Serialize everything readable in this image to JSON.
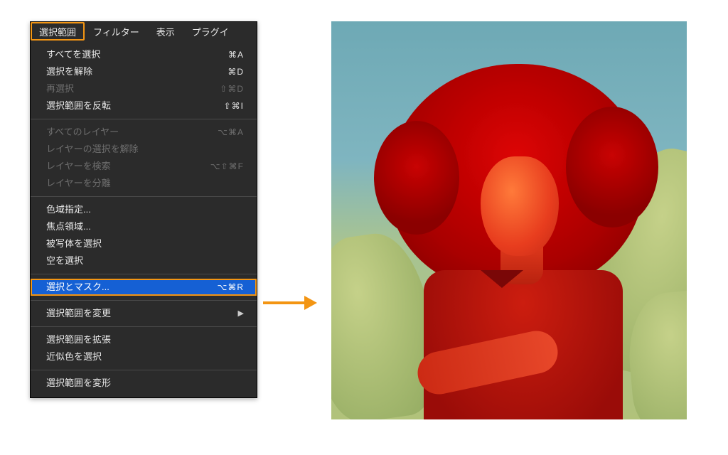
{
  "menubar": {
    "items": [
      {
        "label": "選択範囲",
        "active": true
      },
      {
        "label": "フィルター",
        "active": false
      },
      {
        "label": "表示",
        "active": false
      },
      {
        "label": "プラグイ",
        "active": false
      }
    ]
  },
  "dropdown": {
    "sections": [
      [
        {
          "label": "すべてを選択",
          "shortcut": "⌘A",
          "enabled": true
        },
        {
          "label": "選択を解除",
          "shortcut": "⌘D",
          "enabled": true
        },
        {
          "label": "再選択",
          "shortcut": "⇧⌘D",
          "enabled": false
        },
        {
          "label": "選択範囲を反転",
          "shortcut": "⇧⌘I",
          "enabled": true
        }
      ],
      [
        {
          "label": "すべてのレイヤー",
          "shortcut": "⌥⌘A",
          "enabled": false
        },
        {
          "label": "レイヤーの選択を解除",
          "shortcut": "",
          "enabled": false
        },
        {
          "label": "レイヤーを検索",
          "shortcut": "⌥⇧⌘F",
          "enabled": false
        },
        {
          "label": "レイヤーを分離",
          "shortcut": "",
          "enabled": false
        }
      ],
      [
        {
          "label": "色域指定...",
          "shortcut": "",
          "enabled": true
        },
        {
          "label": "焦点領域...",
          "shortcut": "",
          "enabled": true
        },
        {
          "label": "被写体を選択",
          "shortcut": "",
          "enabled": true
        },
        {
          "label": "空を選択",
          "shortcut": "",
          "enabled": true
        }
      ],
      [
        {
          "label": "選択とマスク...",
          "shortcut": "⌥⌘R",
          "enabled": true,
          "highlighted": true
        }
      ],
      [
        {
          "label": "選択範囲を変更",
          "shortcut": "",
          "enabled": true,
          "submenu": true
        }
      ],
      [
        {
          "label": "選択範囲を拡張",
          "shortcut": "",
          "enabled": true
        },
        {
          "label": "近似色を選択",
          "shortcut": "",
          "enabled": true
        }
      ],
      [
        {
          "label": "選択範囲を変形",
          "shortcut": "",
          "enabled": true
        }
      ]
    ]
  },
  "preview": {
    "description": "Portrait photo with red selection overlay against sky and cactus background"
  },
  "colors": {
    "highlight_orange": "#f39513",
    "menu_highlight_blue": "#1560d4",
    "menu_bg": "#2b2b2b"
  }
}
